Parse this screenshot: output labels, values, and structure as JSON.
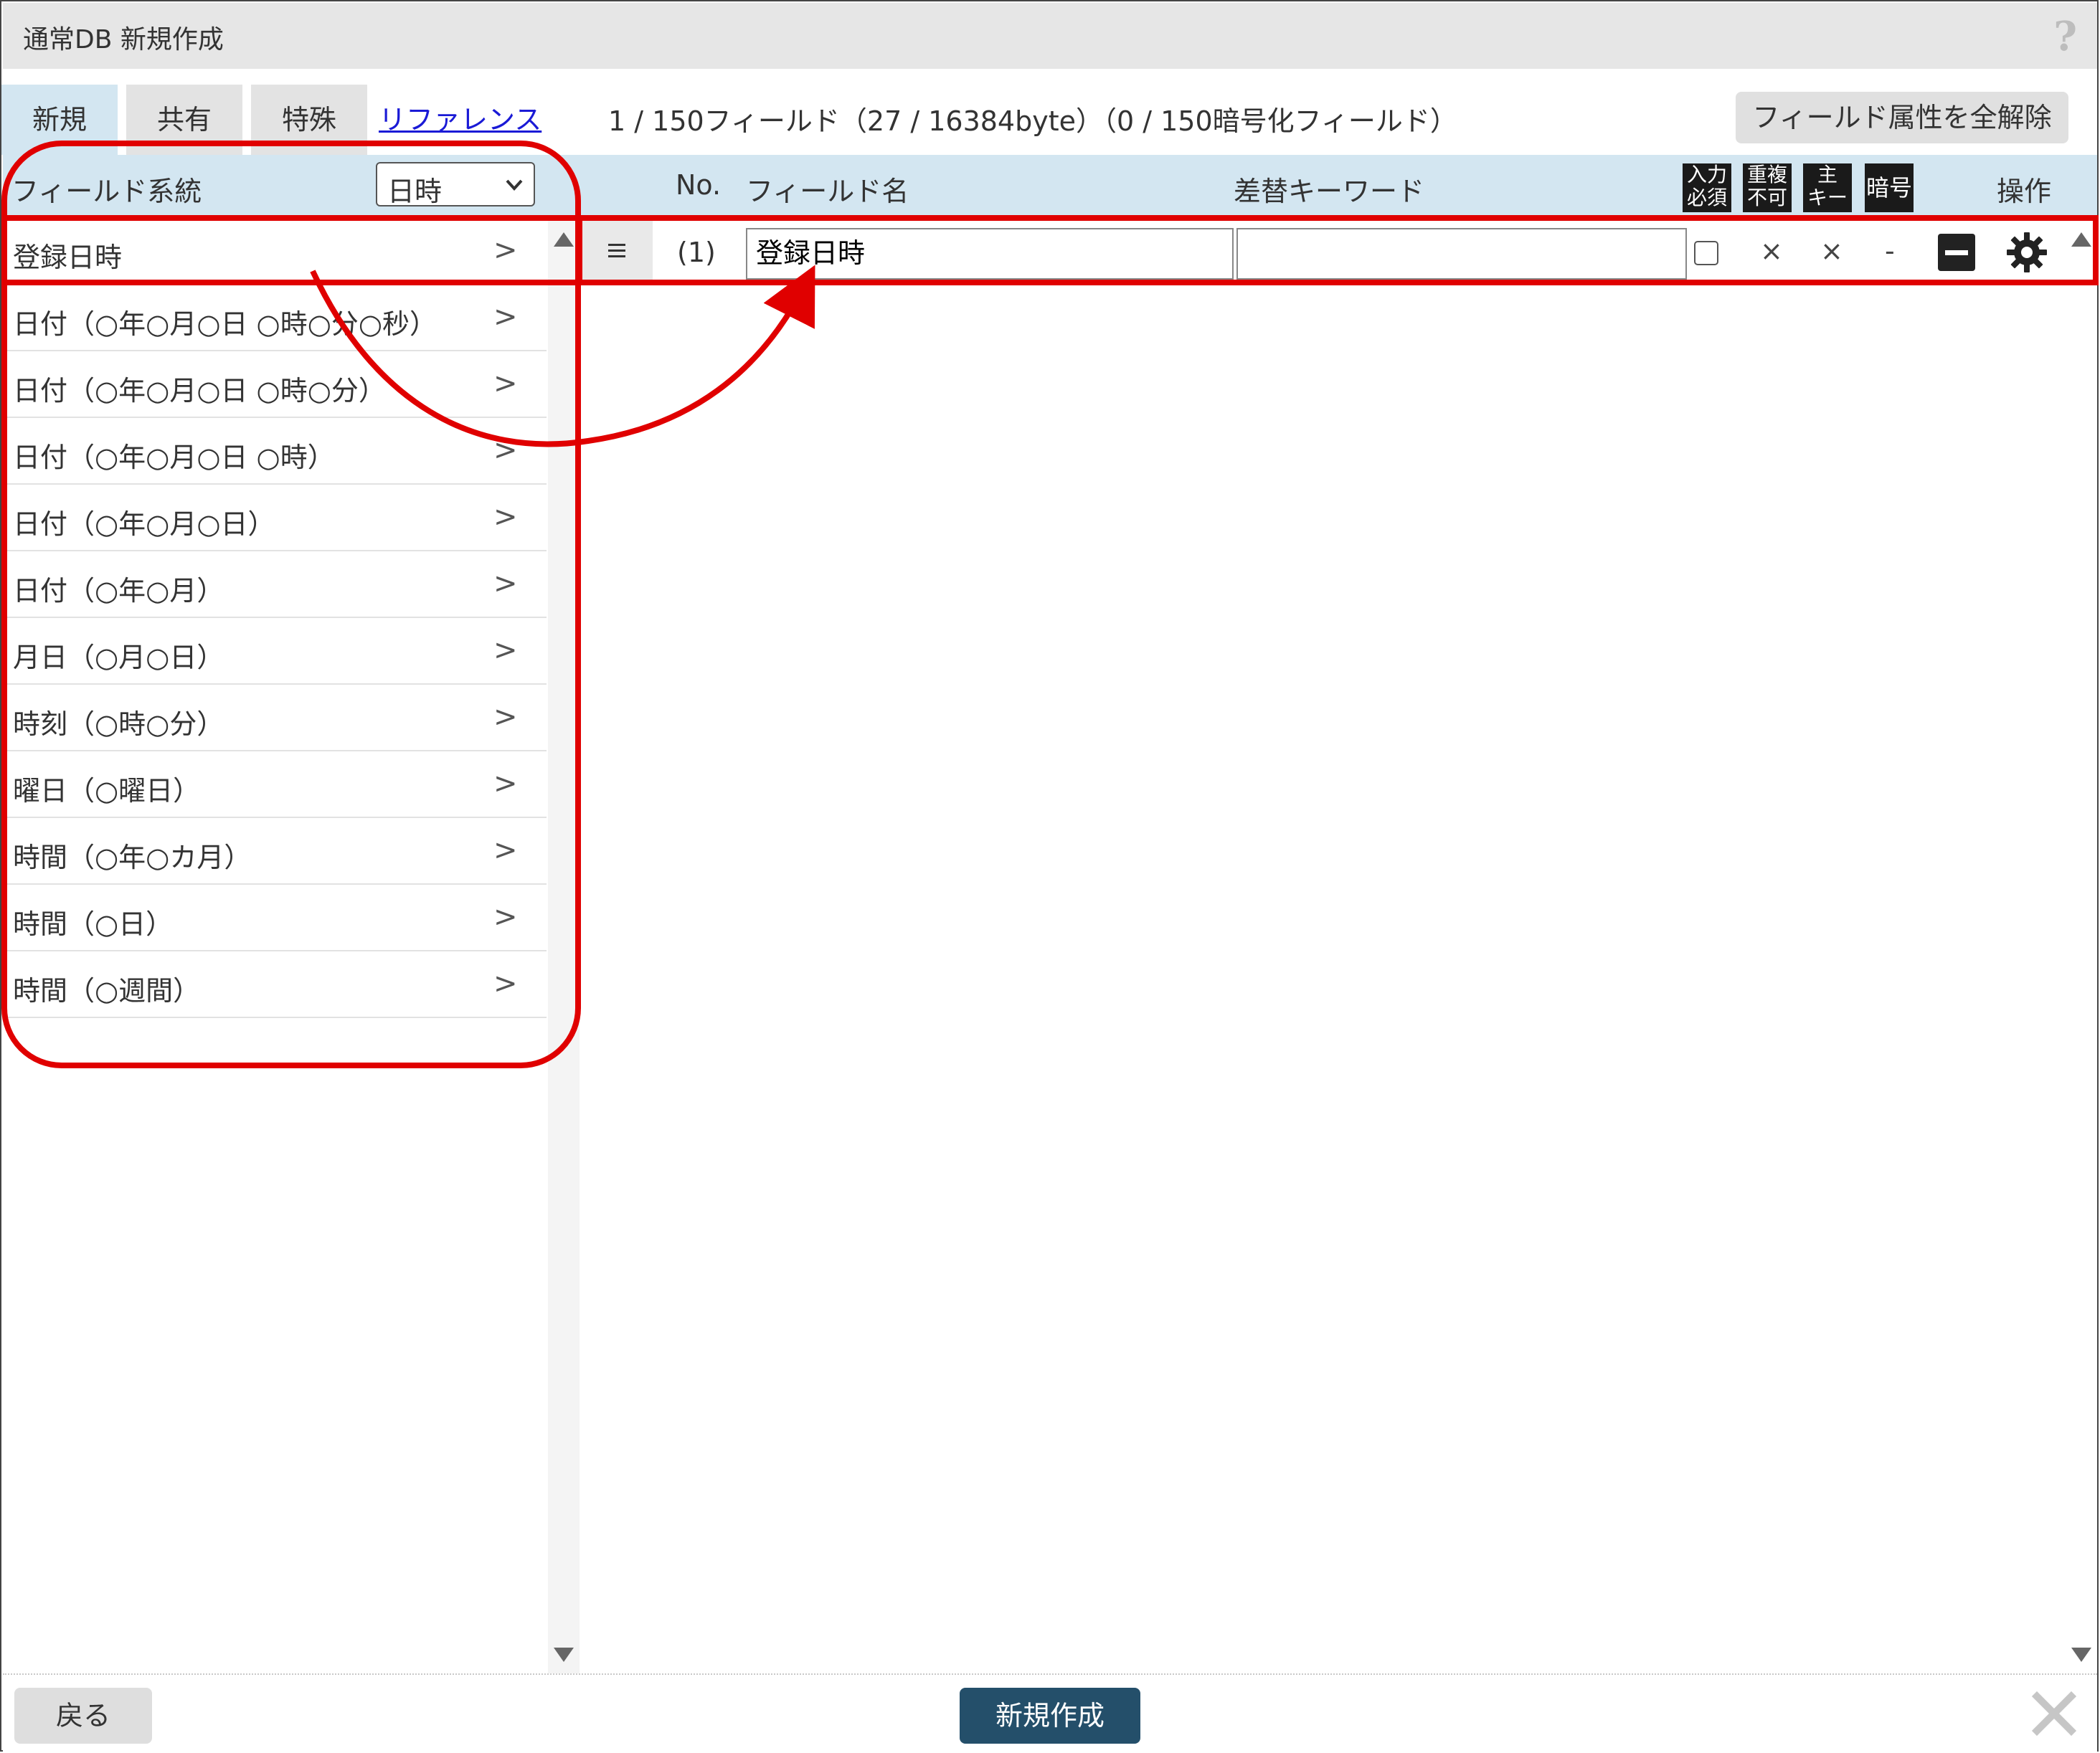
{
  "window": {
    "title": "通常DB 新規作成",
    "help_icon": "?"
  },
  "tabs": [
    {
      "label": "新規",
      "active": true
    },
    {
      "label": "共有",
      "active": false
    },
    {
      "label": "特殊",
      "active": false
    }
  ],
  "reference_link": "リファレンス",
  "field_count_text": "1 / 150フィールド（27 / 16384byte）（0 / 150暗号化フィールド）",
  "clear_all_button": "フィールド属性を全解除",
  "header": {
    "field_type_label": "フィールド系統",
    "type_select_value": "日時",
    "no_label": "No.",
    "field_name_label": "フィールド名",
    "keyword_label": "差替キーワード",
    "attr_icons": [
      {
        "line1": "入力",
        "line2": "必須"
      },
      {
        "line1": "重複",
        "line2": "不可"
      },
      {
        "line1": "主",
        "line2": "キー"
      },
      {
        "line1": "暗号",
        "line2": ""
      }
    ],
    "operation_label": "操作"
  },
  "field_types": [
    {
      "label": "登録日時",
      "arrow": ">"
    },
    {
      "label": "日付（○年○月○日 ○時○分○秒）",
      "arrow": ">"
    },
    {
      "label": "日付（○年○月○日 ○時○分）",
      "arrow": ">"
    },
    {
      "label": "日付（○年○月○日 ○時）",
      "arrow": ">"
    },
    {
      "label": "日付（○年○月○日）",
      "arrow": ">"
    },
    {
      "label": "日付（○年○月）",
      "arrow": ">"
    },
    {
      "label": "月日（○月○日）",
      "arrow": ">"
    },
    {
      "label": "時刻（○時○分）",
      "arrow": ">"
    },
    {
      "label": "曜日（○曜日）",
      "arrow": ">"
    },
    {
      "label": "時間（○年○カ月）",
      "arrow": ">"
    },
    {
      "label": "時間（○日）",
      "arrow": ">"
    },
    {
      "label": "時間（○週間）",
      "arrow": ">"
    }
  ],
  "field_rows": [
    {
      "no": "(1)",
      "field_name": "登録日時",
      "keyword": "",
      "required_checked": false,
      "unique_mark": "×",
      "primary_key_mark": "×",
      "encrypt_mark": "-"
    }
  ],
  "footer": {
    "back_button": "戻る",
    "create_button": "新規作成"
  },
  "colors": {
    "accent": "#244f6a",
    "header_bg": "#d3e6f1",
    "annotation": "#e00000",
    "link": "#1a1ad6"
  },
  "icons": [
    "help-icon",
    "chevron-down-icon",
    "drag-handle-icon",
    "minus-icon",
    "gear-icon",
    "close-icon",
    "scroll-up-icon",
    "scroll-down-icon"
  ]
}
